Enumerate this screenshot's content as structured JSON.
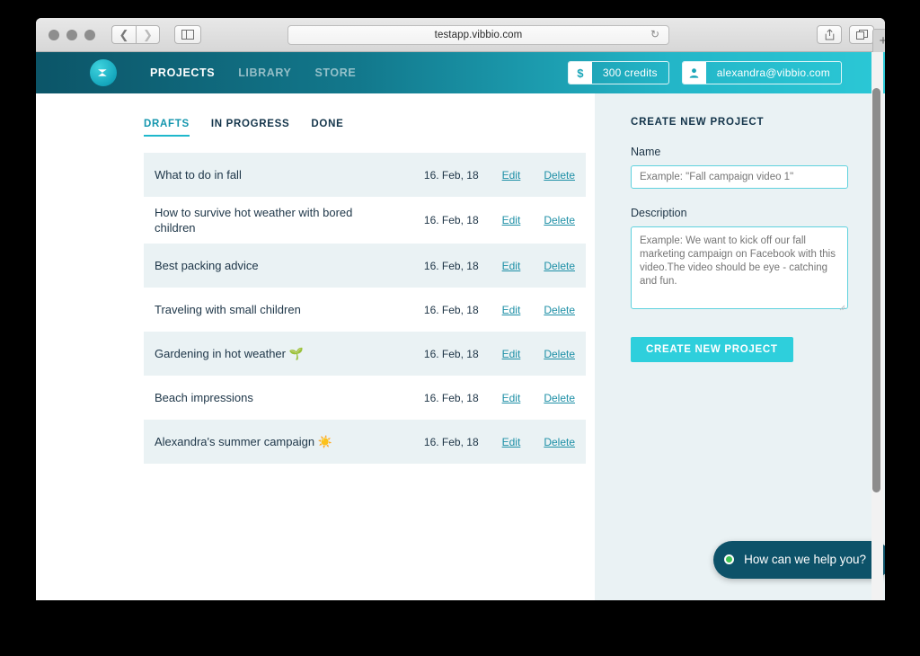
{
  "browser": {
    "url": "testapp.vibbio.com",
    "back_icon": "chevron-left-icon",
    "forward_icon": "chevron-right-icon",
    "reload_icon": "↻",
    "share_icon": "⇧",
    "tabs_icon": "⧉",
    "new_tab_icon": "+"
  },
  "header": {
    "nav": [
      {
        "label": "PROJECTS",
        "active": true
      },
      {
        "label": "LIBRARY",
        "active": false
      },
      {
        "label": "STORE",
        "active": false
      }
    ],
    "credits": {
      "icon": "$",
      "label": "300 credits"
    },
    "account": {
      "icon": "person-icon",
      "label": "alexandra@vibbio.com"
    },
    "gradient_from": "#0c5568",
    "gradient_to": "#2bc8d6"
  },
  "main": {
    "tabs": [
      {
        "label": "DRAFTS",
        "active": true
      },
      {
        "label": "IN PROGRESS",
        "active": false
      },
      {
        "label": "DONE",
        "active": false
      }
    ],
    "actions": {
      "edit": "Edit",
      "delete": "Delete"
    },
    "projects": [
      {
        "title": "What to do in fall",
        "date": "16. Feb, 18"
      },
      {
        "title": "How to survive hot weather with bored children",
        "date": "16. Feb, 18"
      },
      {
        "title": "Best packing advice",
        "date": "16. Feb, 18"
      },
      {
        "title": "Traveling with small children",
        "date": "16. Feb, 18"
      },
      {
        "title": "Gardening in hot weather 🌱",
        "date": "16. Feb, 18"
      },
      {
        "title": "Beach impressions",
        "date": "16. Feb, 18"
      },
      {
        "title": "Alexandra's summer campaign ☀️",
        "date": "16. Feb, 18"
      }
    ]
  },
  "sidebar": {
    "title": "CREATE NEW PROJECT",
    "name_label": "Name",
    "name_placeholder": "Example: \"Fall campaign video 1\"",
    "description_label": "Description",
    "description_placeholder": "Example: We want to kick off our fall marketing campaign on Facebook with this video.The video should be eye - catching and fun.",
    "submit_label": "CREATE NEW PROJECT",
    "accent_color": "#2ecfdc"
  },
  "chat": {
    "message": "How can we help you?",
    "bubble_color": "#0d5269",
    "status_color": "#3fc553"
  }
}
